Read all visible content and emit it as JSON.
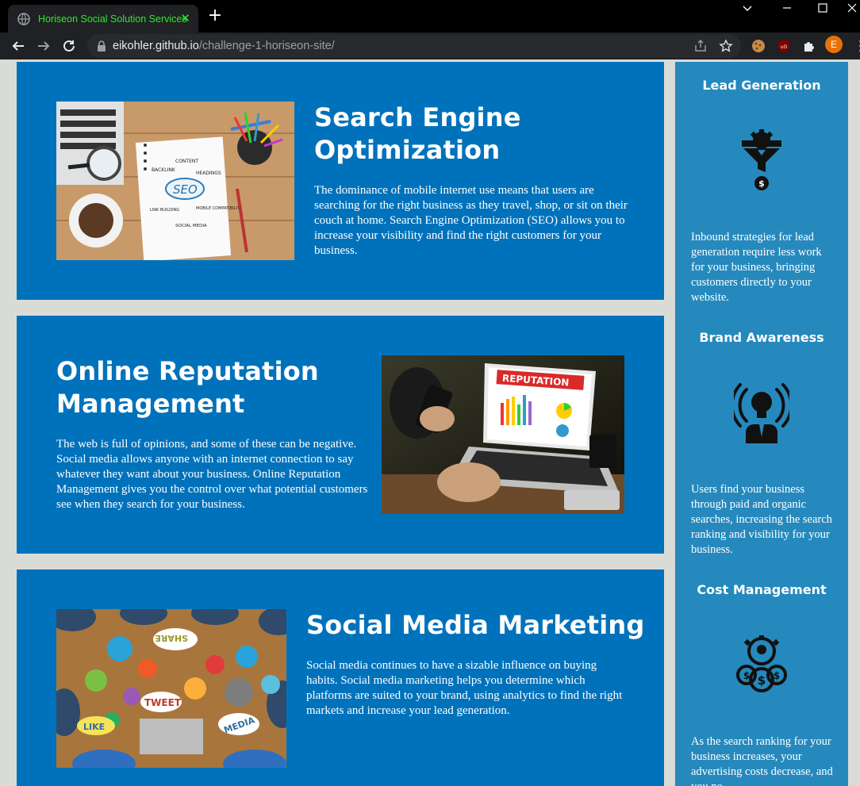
{
  "browser": {
    "tab_title": "Horiseon Social Solution Services",
    "tab_close": "✕",
    "new_tab": "+",
    "url_host": "eikohler.github.io",
    "url_path": "/challenge-1-horiseon-site/",
    "profile_initial": "E",
    "accent_color": "#2ee82e"
  },
  "sections": {
    "seo": {
      "title_line1": "Search Engine",
      "title_line2": "Optimization",
      "body": "The dominance of mobile internet use means that users are searching for the right business as they travel, shop, or sit on their couch at home. Search Engine Optimization (SEO) allows you to increase your visibility and find the right customers for your business.",
      "image_words": [
        "CONTENT",
        "BACKLINK",
        "HEADINGS",
        "SEO",
        "LINK BUILDING",
        "MOBILE COMPATIBILITY",
        "SOCIAL MEDIA"
      ]
    },
    "orm": {
      "title_line1": "Online Reputation",
      "title_line2": "Management",
      "body": "The web is full of opinions, and some of these can be negative. Social media allows anyone with an internet connection to say whatever they want about your business. Online Reputation Management gives you the control over what potential customers see when they search for your business.",
      "image_words": [
        "REPUTATION"
      ]
    },
    "smm": {
      "title": "Social Media Marketing",
      "body": "Social media continues to have a sizable influence on buying habits. Social media marketing helps you determine which platforms are suited to your brand, using analytics to find the right markets and increase your lead generation.",
      "image_words": [
        "SHARE",
        "TWEET",
        "LIKE",
        "MEDIA"
      ]
    }
  },
  "benefits": [
    {
      "title": "Lead Generation",
      "icon": "funnel-gear-dollar-icon",
      "body": "Inbound strategies for lead generation require less work for your business, bringing customers directly to your website."
    },
    {
      "title": "Brand Awareness",
      "icon": "lightbulb-person-icon",
      "body": "Users find your business through paid and organic searches, increasing the search ranking and visibility for your business."
    },
    {
      "title": "Cost Management",
      "icon": "gear-person-coins-icon",
      "body": "As the search ranking for your business increases, your advertising costs decrease, and you no"
    }
  ],
  "colors": {
    "card_bg": "#0072bb",
    "sidebar_bg": "#2589bd",
    "page_bg": "#d9dcd6"
  }
}
